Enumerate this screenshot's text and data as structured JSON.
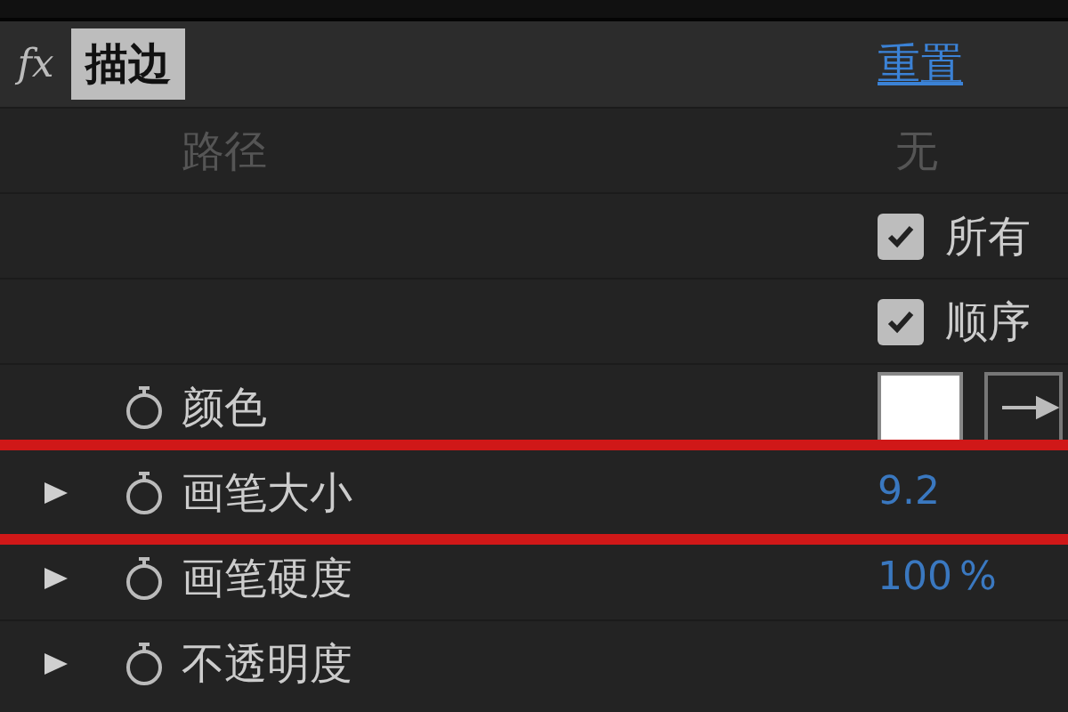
{
  "effect": {
    "fx": "fx",
    "name": "描边",
    "reset": "重置"
  },
  "rows": [
    {
      "kind": "text",
      "label": "路径",
      "value": "无",
      "disabled": true,
      "expandable": false,
      "animatable": false,
      "highlighted": false
    },
    {
      "kind": "checkbox",
      "text": "所有",
      "checked": true,
      "expandable": false,
      "animatable": false,
      "highlighted": false
    },
    {
      "kind": "checkbox",
      "text": "顺序",
      "checked": true,
      "expandable": false,
      "animatable": false,
      "highlighted": false
    },
    {
      "kind": "color",
      "label": "颜色",
      "color": "#ffffff",
      "expandable": false,
      "animatable": true,
      "highlighted": false
    },
    {
      "kind": "number",
      "label": "画笔大小",
      "value": "9.2",
      "expandable": true,
      "animatable": true,
      "highlighted": true
    },
    {
      "kind": "number",
      "label": "画笔硬度",
      "value": "100",
      "unit": "%",
      "expandable": true,
      "animatable": true,
      "highlighted": false
    },
    {
      "kind": "number",
      "label": "不透明度",
      "expandable": true,
      "animatable": true,
      "highlighted": false
    }
  ]
}
